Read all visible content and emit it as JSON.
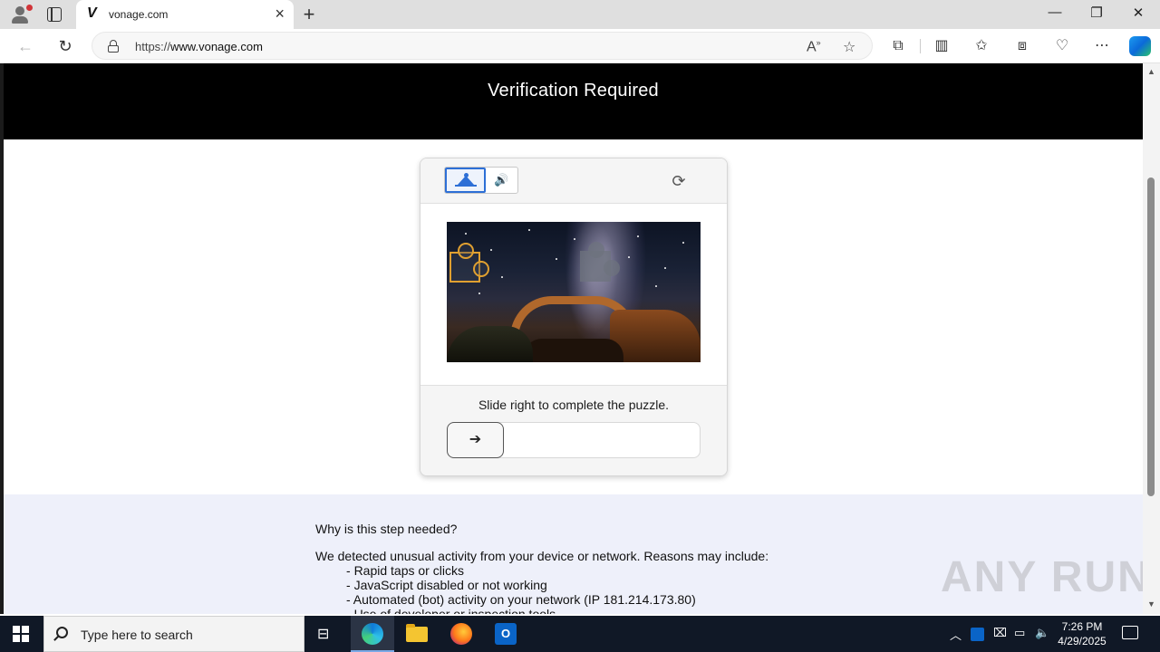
{
  "browser": {
    "tab_title": "vonage.com",
    "tab_favicon": "V",
    "url_prefix": "https://",
    "url_host": "www.vonage.com"
  },
  "page": {
    "banner_title": "Verification Required",
    "captcha": {
      "instruction": "Slide right to complete the puzzle.",
      "slider_arrow": "➔",
      "refresh_glyph": "⟳",
      "audio_glyph": "🔊"
    },
    "info": {
      "question": "Why is this step needed?",
      "lead": "We detected unusual activity from your device or network. Reasons may include:",
      "reasons": [
        "Rapid taps or clicks",
        "JavaScript disabled or not working",
        "Automated (bot) activity on your network (IP 181.214.173.80)",
        "Use of developer or inspection tools"
      ]
    },
    "watermark": "ANY RUN"
  },
  "taskbar": {
    "search_placeholder": "Type here to search",
    "time": "7:26 PM",
    "date": "4/29/2025"
  },
  "colors": {
    "accent_blue": "#2d6fd6",
    "banner_bg": "#000000",
    "info_bg": "#eef0fa",
    "puzzle_outline": "#e0a030"
  },
  "icons": [
    "profile-icon",
    "tab-actions-icon",
    "back-icon",
    "refresh-icon",
    "lock-icon",
    "read-aloud-icon",
    "favorite-star-icon",
    "extensions-icon",
    "split-screen-icon",
    "favorites-icon",
    "collections-icon",
    "browser-essentials-icon",
    "more-icon",
    "copilot-icon",
    "image-challenge-icon",
    "audio-challenge-icon",
    "reload-challenge-icon",
    "slider-arrow-icon"
  ]
}
